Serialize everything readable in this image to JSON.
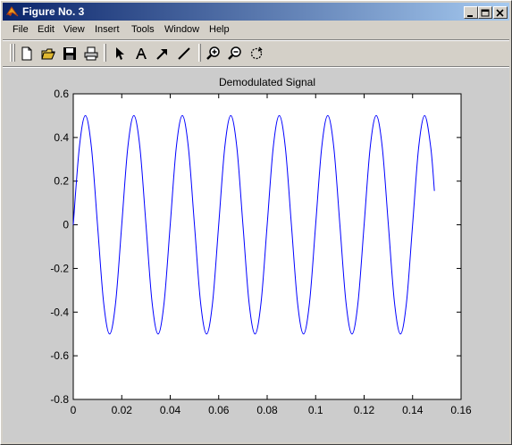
{
  "window": {
    "title": "Figure No. 3",
    "title_bar_color": "#0a246a"
  },
  "menu": {
    "items": [
      "File",
      "Edit",
      "View",
      "Insert",
      "Tools",
      "Window",
      "Help"
    ]
  },
  "toolbar": {
    "tools": [
      "new-file-icon",
      "open-folder-icon",
      "save-icon",
      "print-icon",
      "select-arrow-icon",
      "text-icon",
      "arrow-icon",
      "line-icon",
      "zoom-in-icon",
      "zoom-out-icon",
      "rotate-icon"
    ]
  },
  "chart_data": {
    "type": "line",
    "title": "Demodulated Signal",
    "xlabel": "",
    "ylabel": "",
    "xlim": [
      0,
      0.16
    ],
    "ylim": [
      -0.8,
      0.6
    ],
    "x_ticks": [
      0,
      0.02,
      0.04,
      0.06,
      0.08,
      0.1,
      0.12,
      0.14,
      0.16
    ],
    "x_tick_labels": [
      "0",
      "0.02",
      "0.04",
      "0.06",
      "0.08",
      "0.1",
      "0.12",
      "0.14",
      "0.16"
    ],
    "y_ticks": [
      -0.8,
      -0.6,
      -0.4,
      -0.2,
      0,
      0.2,
      0.4,
      0.6
    ],
    "y_tick_labels": [
      "-0.8",
      "-0.6",
      "-0.4",
      "-0.2",
      "0",
      "0.2",
      "0.4",
      "0.6"
    ],
    "grid": false,
    "series": [
      {
        "color": "#0000ff",
        "x": [
          0,
          0.0025,
          0.005,
          0.0075,
          0.01,
          0.0125,
          0.015,
          0.0175,
          0.02,
          0.0225,
          0.025,
          0.0275,
          0.03,
          0.0325,
          0.035,
          0.0375,
          0.04,
          0.0425,
          0.045,
          0.0475,
          0.05,
          0.0525,
          0.055,
          0.0575,
          0.06,
          0.0625,
          0.065,
          0.0675,
          0.07,
          0.0725,
          0.075,
          0.0775,
          0.08,
          0.0825,
          0.085,
          0.0875,
          0.09,
          0.0925,
          0.095,
          0.0975,
          0.1,
          0.1025,
          0.105,
          0.1075,
          0.11,
          0.1125,
          0.115,
          0.1175,
          0.12,
          0.1225,
          0.125,
          0.1275,
          0.13,
          0.1325,
          0.135,
          0.1375,
          0.14,
          0.1425,
          0.145,
          0.1475,
          0.149
        ],
        "y": [
          0,
          0.354,
          0.5,
          0.354,
          0,
          -0.354,
          -0.5,
          -0.354,
          0,
          0.354,
          0.5,
          0.354,
          0,
          -0.354,
          -0.5,
          -0.354,
          0,
          0.354,
          0.5,
          0.354,
          0,
          -0.354,
          -0.5,
          -0.354,
          0,
          0.354,
          0.5,
          0.354,
          0,
          -0.354,
          -0.5,
          -0.354,
          0,
          0.354,
          0.5,
          0.354,
          0,
          -0.354,
          -0.5,
          -0.354,
          0,
          0.354,
          0.5,
          0.354,
          0,
          -0.354,
          -0.5,
          -0.354,
          0,
          0.354,
          0.5,
          0.354,
          0,
          -0.354,
          -0.5,
          -0.354,
          0,
          0.354,
          0.5,
          0.354,
          0.155
        ]
      }
    ]
  }
}
